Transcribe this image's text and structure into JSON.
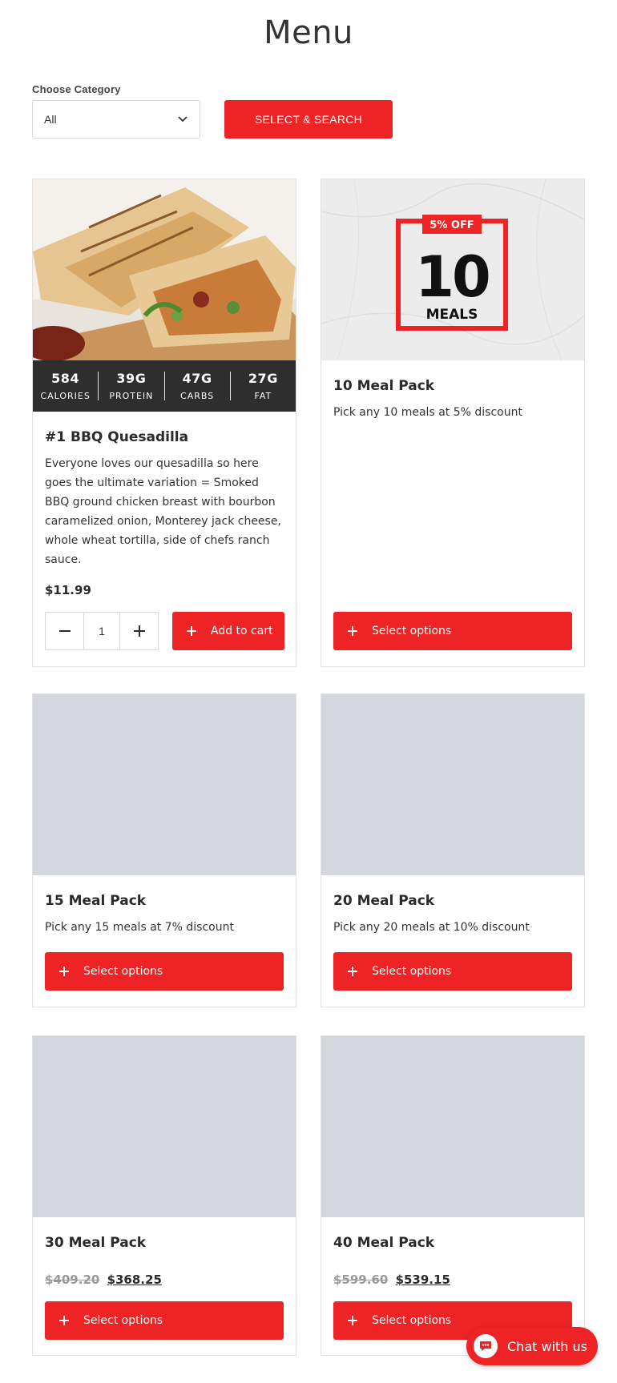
{
  "page": {
    "title": "Menu"
  },
  "filter": {
    "label": "Choose Category",
    "selected": "All",
    "button_label": "SELECT & SEARCH"
  },
  "colors": {
    "accent": "#ee2326",
    "nutrition_bar": "#2e2e2e",
    "placeholder": "#d5d7df"
  },
  "products": [
    {
      "title": "#1 BBQ Quesadilla",
      "description": "Everyone loves our quesadilla so here goes the ultimate variation = Smoked BBQ ground chicken breast with bourbon caramelized onion, Monterey jack cheese, whole wheat tortilla, side of chefs ranch sauce.",
      "price": "$11.99",
      "quantity": "1",
      "button_label": "Add to cart",
      "nutrition": [
        {
          "value": "584",
          "label": "CALORIES"
        },
        {
          "value": "39G",
          "label": "PROTEIN"
        },
        {
          "value": "47G",
          "label": "CARBS"
        },
        {
          "value": "27G",
          "label": "FAT"
        }
      ]
    },
    {
      "title": "10 Meal Pack",
      "description": "Pick any 10 meals at 5% discount",
      "button_label": "Select options",
      "image_text": {
        "badge": "5% OFF",
        "number": "10",
        "word": "MEALS"
      }
    },
    {
      "title": "15 Meal Pack",
      "description": "Pick any 15 meals at 7% discount",
      "button_label": "Select options"
    },
    {
      "title": "20 Meal Pack",
      "description": "Pick any 20 meals at 10% discount",
      "button_label": "Select options"
    },
    {
      "title": "30 Meal Pack",
      "old_price": "$409.20",
      "price": "$368.25",
      "button_label": "Select options"
    },
    {
      "title": "40 Meal Pack",
      "old_price": "$599.60",
      "price": "$539.15",
      "button_label": "Select options"
    }
  ],
  "chat": {
    "label": "Chat with us"
  }
}
